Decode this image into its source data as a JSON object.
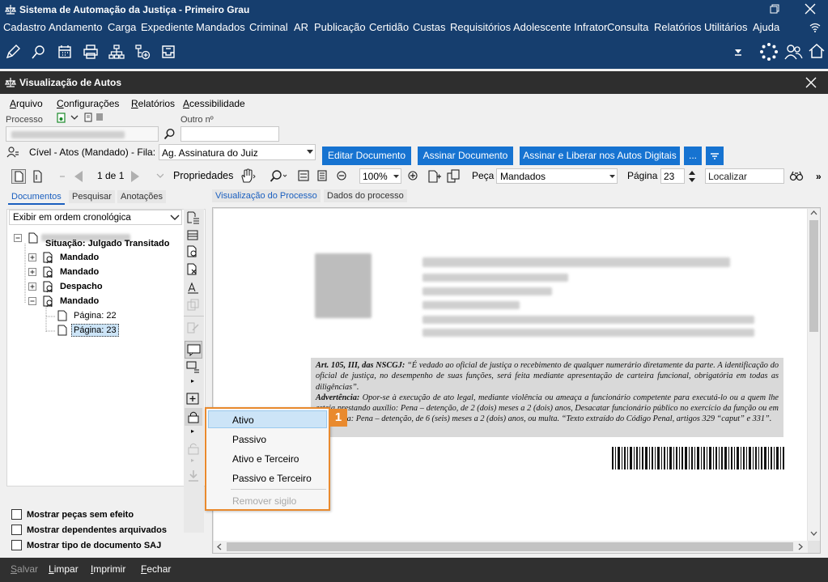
{
  "app": {
    "title": "Sistema de Automação da Justiça - Primeiro Grau",
    "menu": [
      "Cadastro",
      "Andamento",
      "Carga",
      "Expediente",
      "Mandados",
      "Criminal",
      "AR",
      "Publicação",
      "Certidão",
      "Custas",
      "Requisitórios",
      "Adolescente Infrator",
      "Consulta",
      "Relatórios",
      "Utilitários",
      "Ajuda"
    ]
  },
  "window": {
    "title": "Visualização de Autos",
    "menu": [
      "Arquivo",
      "Configurações",
      "Relatórios",
      "Acessibilidade"
    ]
  },
  "search": {
    "processo_label": "Processo",
    "outro_label": "Outro nº"
  },
  "queue": {
    "text": "Cível - Atos (Mandado) - Fila:",
    "select_value": "Ag. Assinatura do Juiz",
    "buttons": [
      "Editar Documento",
      "Assinar Documento",
      "Assinar e Liberar nos Autos Digitais",
      "..."
    ]
  },
  "toolbar": {
    "page_nav": "1 de 1",
    "properties": "Propriedades",
    "zoom": "100%",
    "peca_label": "Peça",
    "peca_value": "Mandados",
    "pagina_label": "Página",
    "pagina_value": "23",
    "find_placeholder": "Localizar"
  },
  "left_tabs": [
    "Documentos",
    "Pesquisar",
    "Anotações"
  ],
  "viewer_tabs": [
    "Visualização do Processo",
    "Dados do processo"
  ],
  "sort_select": "Exibir em ordem cronológica",
  "tree": {
    "situacao": "Situação: Julgado Transitado",
    "nodes": [
      "Mandado",
      "Mandado",
      "Despacho",
      "Mandado"
    ],
    "pages": [
      "Página: 22",
      "Página: 23"
    ]
  },
  "document": {
    "legal_head": "Art. 105, III, das NSCGJ:",
    "legal_text": "“É vedado ao oficial de justiça o recebimento de qualquer numerário diretamente da parte. A identificação do oficial de justiça, no desempenho de suas funções, será feita mediante apresentação de carteira funcional, obrigatória em todas as diligências”.",
    "advert_head": "Advertência:",
    "advert_text": "Opor-se à execução de ato legal, mediante violência ou ameaça a funcionário competente para executá-lo ou a quem lhe esteja prestando auxílio: Pena – detenção, de 2 (dois) meses a 2 (dois) anos, Desacatar funcionário público no exercício da função ou em razão dela: Pena – detenção, de 6 (seis) meses a 2 (dois) anos, ou multa. “Texto extraído do Código Penal, artigos 329 “caput” e 331”."
  },
  "context_menu": {
    "items": [
      "Ativo",
      "Passivo",
      "Ativo e Terceiro",
      "Passivo e Terceiro"
    ],
    "disabled_item": "Remover sigilo",
    "badge": "1"
  },
  "options": [
    "Mostrar peças sem efeito",
    "Mostrar dependentes arquivados",
    "Mostrar tipo de documento SAJ"
  ],
  "footer": [
    "Salvar",
    "Limpar",
    "Imprimir",
    "Fechar"
  ],
  "colors": {
    "app_bar": "#163e6e",
    "accent_blue": "#1673d1",
    "highlight_orange": "#e98a2e"
  }
}
